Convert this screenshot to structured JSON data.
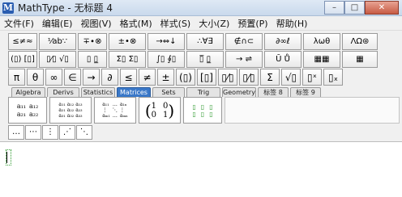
{
  "window": {
    "app_icon_letter": "M",
    "title": "MathType - 无标题 4",
    "controls": {
      "minimize": "–",
      "maximize": "□",
      "close": "✕"
    }
  },
  "menu": [
    "文件(F)",
    "编辑(E)",
    "视图(V)",
    "格式(M)",
    "样式(S)",
    "大小(Z)",
    "预置(P)",
    "帮助(H)"
  ],
  "palette_row1": [
    "≤≠≈",
    "⅟ab∵",
    "∓∙⊗",
    "±•⊗",
    "→⇔↓",
    "∴∀∃",
    "∉∩⊂",
    "∂∞ℓ",
    "λωθ",
    "ΛΩ⊛"
  ],
  "palette_row2": [
    "(▯) [▯]",
    "▯⁄▯ √▯",
    "▯ ▯̲",
    "Σ▯ Σ▯",
    "∫▯ ∮▯",
    "▯̅ ▯̲",
    "→ ⇌",
    "Ū Ů",
    "▦▦",
    "▦"
  ],
  "palette_row3": [
    "π",
    "θ",
    "∞",
    "∈",
    "→",
    "∂",
    "≤",
    "≠",
    "±",
    "(▯)",
    "[▯]",
    "▯⁄▯",
    "▯⁄▯",
    "Σ",
    "√▯",
    "▯ˣ",
    "▯ₓ"
  ],
  "tabs": [
    "Algebra",
    "Derivs",
    "Statistics",
    "Matrices",
    "Sets",
    "Trig",
    "Geometry",
    "标签 8",
    "标签 9"
  ],
  "active_tab": "Matrices",
  "templates": {
    "t1": [
      "a₁₁",
      "a₁₂",
      "a₂₁",
      "a₂₂"
    ],
    "t2": [
      "a₁₁",
      "a₁₂",
      "a₁₃",
      "a₂₁",
      "a₂₂",
      "a₂₃",
      "a₃₁",
      "a₃₂",
      "a₃₃"
    ],
    "t3": [
      "a₁₁",
      "…",
      "a₁ₙ",
      "⋮",
      "⋱",
      "⋮",
      "aₘ₁",
      "…",
      "aₘₙ"
    ],
    "t4": [
      "1",
      "0",
      "0",
      "1"
    ],
    "t5": [
      "▯",
      "▯",
      "▯",
      "▯",
      "▯",
      "▯"
    ]
  },
  "dots_row": [
    "…",
    "⋯",
    "⋮",
    "⋰",
    "⋱"
  ]
}
